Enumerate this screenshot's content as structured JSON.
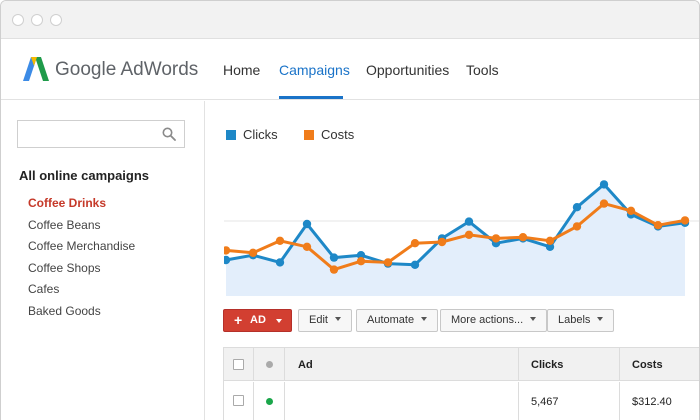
{
  "brand": {
    "name": "Google AdWords"
  },
  "nav": {
    "items": [
      {
        "label": "Home"
      },
      {
        "label": "Campaigns"
      },
      {
        "label": "Opportunities"
      },
      {
        "label": "Tools"
      }
    ],
    "active": "Campaigns"
  },
  "sidebar": {
    "search": {
      "placeholder": ""
    },
    "heading": "All online campaigns",
    "items": [
      {
        "label": "Coffee Drinks"
      },
      {
        "label": "Coffee Beans"
      },
      {
        "label": "Coffee Merchandise"
      },
      {
        "label": "Coffee Shops"
      },
      {
        "label": "Cafes"
      },
      {
        "label": "Baked Goods"
      }
    ],
    "active": "Coffee Drinks"
  },
  "legend": {
    "clicks": "Clicks",
    "costs": "Costs"
  },
  "colors": {
    "clicks": "#1e88c7",
    "costs": "#f07c1a",
    "accent": "#1a73c8",
    "ad_button": "#d23f31",
    "active_campaign": "#c53929",
    "status_active": "#1aa64a"
  },
  "chart_data": {
    "type": "line",
    "title": "",
    "xlabel": "",
    "ylabel": "",
    "grid": true,
    "ylim": [
      0,
      100
    ],
    "x": [
      1,
      2,
      3,
      4,
      5,
      6,
      7,
      8,
      9,
      10,
      11,
      12,
      13,
      14,
      15,
      16,
      17,
      18
    ],
    "series": [
      {
        "name": "Clicks",
        "values": [
          30,
          34,
          28,
          60,
          32,
          34,
          27,
          26,
          48,
          62,
          44,
          48,
          41,
          74,
          93,
          68,
          58,
          61
        ]
      },
      {
        "name": "Costs",
        "values": [
          38,
          36,
          46,
          41,
          22,
          29,
          28,
          44,
          45,
          51,
          48,
          49,
          46,
          58,
          77,
          71,
          59,
          63
        ]
      }
    ]
  },
  "toolbar": {
    "ad_label": "AD",
    "edit_label": "Edit",
    "automate_label": "Automate",
    "more_actions_label": "More actions...",
    "labels_label": "Labels"
  },
  "table": {
    "headers": {
      "ad": "Ad",
      "clicks": "Clicks",
      "costs": "Costs"
    },
    "rows": [
      {
        "ad": "",
        "clicks": "5,467",
        "costs": "$312.40"
      }
    ]
  }
}
